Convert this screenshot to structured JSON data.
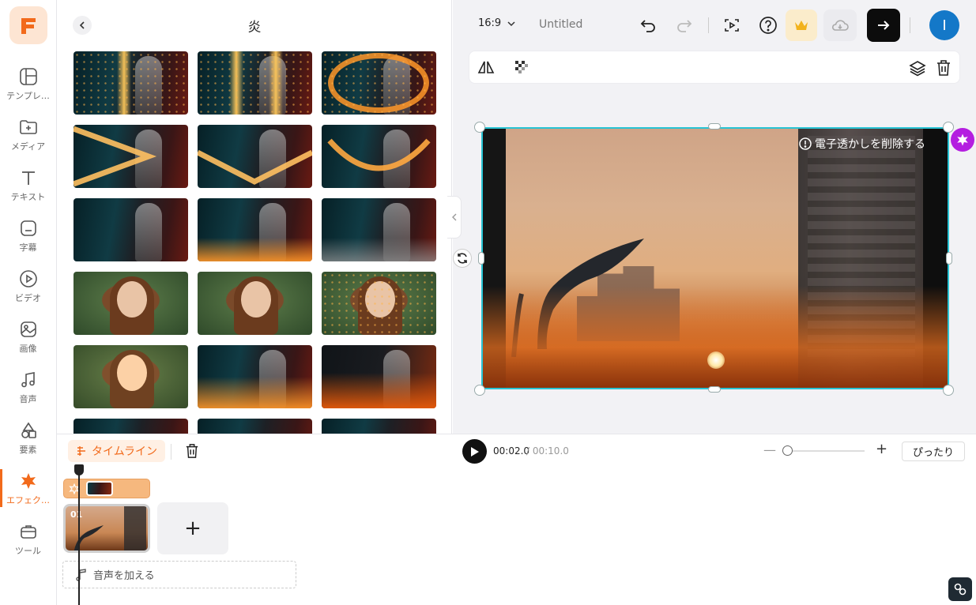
{
  "rail": {
    "items": [
      {
        "label": "テンプレ…",
        "icon": "layout-icon"
      },
      {
        "label": "メディア",
        "icon": "folder-plus-icon"
      },
      {
        "label": "テキスト",
        "icon": "text-icon"
      },
      {
        "label": "字幕",
        "icon": "subtitle-icon"
      },
      {
        "label": "ビデオ",
        "icon": "video-icon"
      },
      {
        "label": "画像",
        "icon": "image-icon"
      },
      {
        "label": "音声",
        "icon": "music-icon"
      },
      {
        "label": "要素",
        "icon": "shapes-icon"
      },
      {
        "label": "エフェク…",
        "icon": "effects-icon"
      },
      {
        "label": "ツール",
        "icon": "toolbox-icon"
      }
    ],
    "active_index": 8,
    "accent": "#f26a1b"
  },
  "panel": {
    "title": "炎"
  },
  "header": {
    "aspect_ratio": "16:9",
    "doc_title": "Untitled",
    "avatar_initial": "I"
  },
  "canvas": {
    "watermark_text": "電子透かしを削除する",
    "selection_color": "#29c4d4",
    "badge_color": "#b41ee0"
  },
  "timeline": {
    "tab_label": "タイムライン",
    "current_time": "00:02.0",
    "total_time": "/ 00:10.0",
    "fit_label": "ぴったり",
    "clip_number": "01",
    "add_audio_label": "音声を加える"
  }
}
